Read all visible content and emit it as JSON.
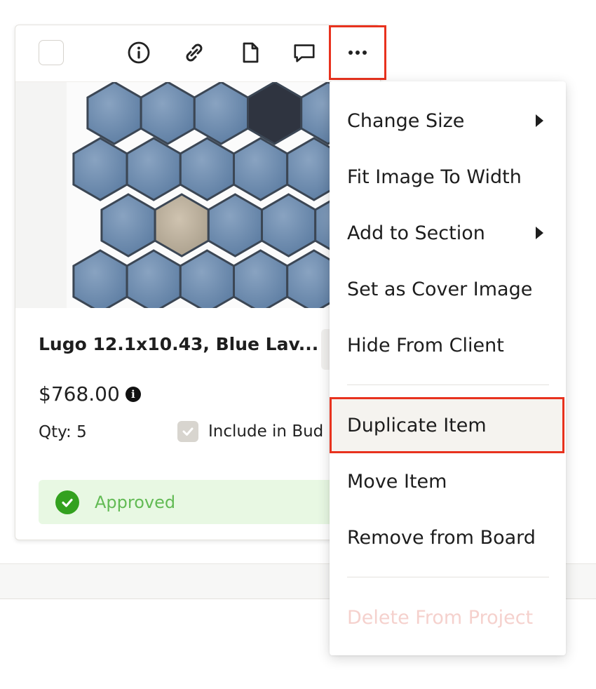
{
  "card": {
    "product_name": "Lugo 12.1x10.43, Blue Lav...",
    "price": "$768.00",
    "price_info_symbol": "i",
    "qty": "Qty: 5",
    "include_budget_label": "Include in Bud",
    "include_budget_checked": true,
    "status": "Approved",
    "status_color": "#33a11f",
    "toolbar_icons": [
      "checkbox",
      "info-icon",
      "link-icon",
      "document-icon",
      "comment-icon",
      "more-icon"
    ]
  },
  "menu": {
    "items": [
      {
        "label": "Change Size",
        "submenu": true
      },
      {
        "label": "Fit Image To Width",
        "submenu": false
      },
      {
        "label": "Add to Section",
        "submenu": true
      },
      {
        "label": "Set as Cover Image",
        "submenu": false
      },
      {
        "label": "Hide From Client",
        "submenu": false
      },
      {
        "label": "Duplicate Item",
        "highlighted": true
      },
      {
        "label": "Move Item"
      },
      {
        "label": "Remove from Board"
      },
      {
        "label": "Delete From Project",
        "disabled": true
      }
    ]
  },
  "colors": {
    "highlight_border": "#e8321e",
    "approved_bg": "#e8f8e3",
    "approved_text": "#63bb55",
    "delete_text": "#f5d1cd"
  }
}
